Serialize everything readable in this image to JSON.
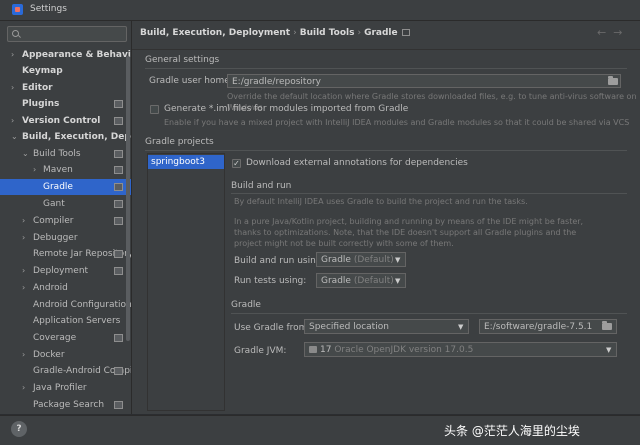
{
  "window": {
    "title": "Settings"
  },
  "sidebar": {
    "search_placeholder": "Q▾",
    "items": [
      {
        "label": "Appearance & Behavior",
        "arrow": "›",
        "bold": true
      },
      {
        "label": "Keymap",
        "arrow": "",
        "bold": true
      },
      {
        "label": "Editor",
        "arrow": "›",
        "bold": true
      },
      {
        "label": "Plugins",
        "arrow": "",
        "bold": true
      },
      {
        "label": "Version Control",
        "arrow": "›",
        "bold": true
      },
      {
        "label": "Build, Execution, Deployment",
        "arrow": "⌄",
        "bold": true
      },
      {
        "label": "Build Tools",
        "arrow": "⌄",
        "bold": false
      },
      {
        "label": "Maven",
        "arrow": "›",
        "bold": false
      },
      {
        "label": "Gradle",
        "arrow": "",
        "bold": false
      },
      {
        "label": "Gant",
        "arrow": "",
        "bold": false
      },
      {
        "label": "Compiler",
        "arrow": "›",
        "bold": false
      },
      {
        "label": "Debugger",
        "arrow": "›",
        "bold": false
      },
      {
        "label": "Remote Jar Repository",
        "arrow": "",
        "bold": false
      },
      {
        "label": "Deployment",
        "arrow": "›",
        "bold": false
      },
      {
        "label": "Android",
        "arrow": "›",
        "bold": false
      },
      {
        "label": "Android Configurations",
        "arrow": "",
        "bold": false
      },
      {
        "label": "Application Servers",
        "arrow": "",
        "bold": false
      },
      {
        "label": "Coverage",
        "arrow": "",
        "bold": false
      },
      {
        "label": "Docker",
        "arrow": "›",
        "bold": false
      },
      {
        "label": "Gradle-Android Compiler",
        "arrow": "",
        "bold": false
      },
      {
        "label": "Java Profiler",
        "arrow": "›",
        "bold": false
      },
      {
        "label": "Package Search",
        "arrow": "",
        "bold": false
      }
    ]
  },
  "breadcrumb": {
    "part1": "Build, Execution, Deployment",
    "part2": "Build Tools",
    "part3": "Gradle",
    "sep": "›"
  },
  "nav": {
    "back": "←",
    "forward": "→"
  },
  "general": {
    "title": "General settings",
    "user_home_label": "Gradle user home:",
    "user_home_value": "E:/gradle/repository",
    "user_home_hint": "Override the default location where Gradle stores downloaded files, e.g. to tune anti-virus software on Windows",
    "iml_label": "Generate *.iml files for modules imported from Gradle",
    "iml_hint": "Enable if you have a mixed project with IntelliJ IDEA modules and Gradle modules so that it could be shared via VCS"
  },
  "projects": {
    "title": "Gradle projects",
    "items": [
      "springboot3"
    ]
  },
  "annotations": {
    "label": "Download external annotations for dependencies",
    "check": "✓"
  },
  "build_run": {
    "title": "Build and run",
    "hint1": "By default IntelliJ IDEA uses Gradle to build the project and run the tasks.",
    "hint2": "In a pure Java/Kotlin project, building and running by means of the IDE might be faster, thanks to optimizations. Note, that the IDE doesn't support all Gradle plugins and the project might not be built correctly with some of them.",
    "build_label": "Build and run using:",
    "build_value": "Gradle",
    "build_suffix": "(Default)",
    "tests_label": "Run tests using:",
    "tests_value": "Gradle",
    "tests_suffix": "(Default)"
  },
  "gradle": {
    "title": "Gradle",
    "use_from_label": "Use Gradle from:",
    "use_from_value": "Specified location",
    "location_value": "E:/software/gradle-7.5.1",
    "jvm_label": "Gradle JVM:",
    "jvm_value": "17",
    "jvm_detail": "Oracle OpenJDK version 17.0.5"
  },
  "bottom": {
    "help": "?",
    "watermark": "头条 @茫茫人海里的尘埃"
  },
  "colors": {
    "accent": "#2f65ca",
    "background": "#3c3f41"
  }
}
